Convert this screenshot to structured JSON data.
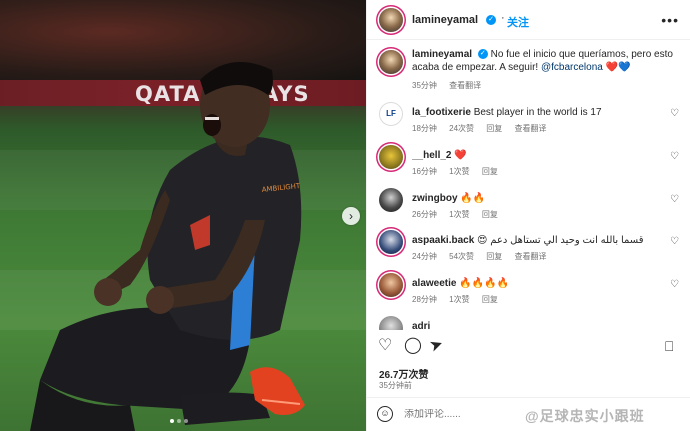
{
  "photo": {
    "board_text_left": "QATA",
    "board_text_right": "AYS",
    "jersey_text": "AMBILIGHT"
  },
  "header": {
    "username": "lamineyamal",
    "follow_label": "关注"
  },
  "caption": {
    "username": "lamineyamal",
    "text": "No fue el inicio que queríamos, pero esto acaba de empezar. A seguir! ",
    "mention": "@fcbarcelona",
    "emojis": "❤️💙",
    "time": "35分钟",
    "translate": "查看翻译"
  },
  "comments": [
    {
      "username": "la_footixerie",
      "text": "Best player in the world is 17",
      "time": "18分钟",
      "likes": "24次赞",
      "reply": "回复",
      "translate": "查看翻译",
      "avatar": "LF"
    },
    {
      "username": "__hell_2",
      "text": "❤️",
      "time": "16分钟",
      "likes": "1次赞",
      "reply": "回复",
      "translate": "",
      "avatar": ""
    },
    {
      "username": "zwingboy",
      "text": "🔥🔥",
      "time": "26分钟",
      "likes": "1次赞",
      "reply": "回复",
      "translate": "",
      "avatar": ""
    },
    {
      "username": "aspaaki.back",
      "text": "😍 قسما بالله انت وحيد الي تستاهل دعم",
      "time": "24分钟",
      "likes": "54次赞",
      "reply": "回复",
      "translate": "查看翻译",
      "avatar": ""
    },
    {
      "username": "alaweetie",
      "text": "🔥🔥🔥🔥",
      "time": "28分钟",
      "likes": "1次赞",
      "reply": "回复",
      "translate": "",
      "avatar": ""
    },
    {
      "username": "adri",
      "text": "",
      "time": "",
      "likes": "",
      "reply": "",
      "translate": "",
      "avatar": ""
    }
  ],
  "actions": {
    "likes": "26.7万次赞",
    "time": "35分钟前"
  },
  "add_comment": {
    "placeholder": "添加评论......",
    "watermark": "@足球忠实小跟班"
  },
  "colors": {
    "accent": "#0095f6",
    "mention": "#00376b",
    "meta": "#737373"
  }
}
